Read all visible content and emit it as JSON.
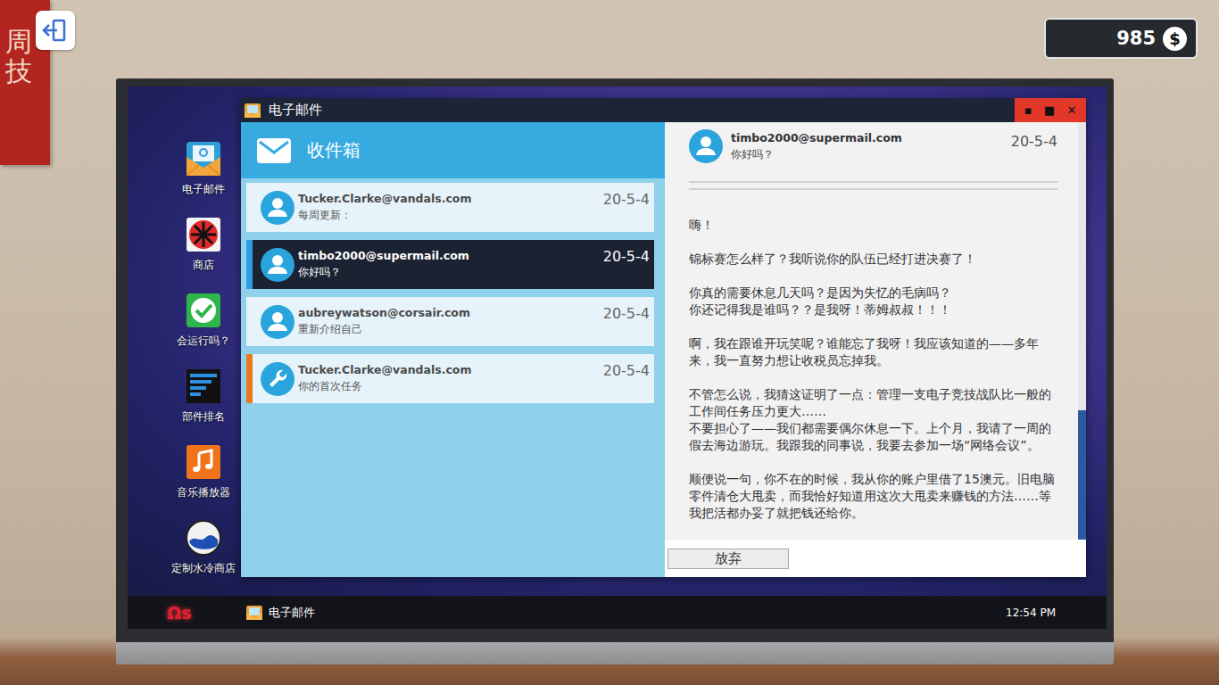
{
  "banner": {
    "text": "周技"
  },
  "money": {
    "amount": "985",
    "icon": "$"
  },
  "desktop": {
    "icons": [
      {
        "label": "电子邮件",
        "kind": "mail"
      },
      {
        "label": "商店",
        "kind": "shop"
      },
      {
        "label": "会运行吗？",
        "kind": "check"
      },
      {
        "label": "部件排名",
        "kind": "ranking"
      },
      {
        "label": "音乐播放器",
        "kind": "music"
      },
      {
        "label": "定制水冷商店",
        "kind": "cooling"
      }
    ]
  },
  "window": {
    "title": "电子邮件",
    "controls": [
      "▪",
      "■",
      "✕"
    ]
  },
  "inbox": {
    "title": "收件箱",
    "mails": [
      {
        "from": "Tucker.Clarke@vandals.com",
        "subject": "每周更新：",
        "date": "20-5-4",
        "kind": "message",
        "selected": false
      },
      {
        "from": "timbo2000@supermail.com",
        "subject": "你好吗？",
        "date": "20-5-4",
        "kind": "message",
        "selected": true
      },
      {
        "from": "aubreywatson@corsair.com",
        "subject": "重新介绍自己",
        "date": "20-5-4",
        "kind": "message",
        "selected": false
      },
      {
        "from": "Tucker.Clarke@vandals.com",
        "subject": "你的首次任务",
        "date": "20-5-4",
        "kind": "task",
        "selected": false
      }
    ]
  },
  "message": {
    "from": "timbo2000@supermail.com",
    "subject": "你好吗？",
    "date": "20-5-4",
    "paragraphs": [
      [
        "嗨！"
      ],
      [
        "锦标赛怎么样了？我听说你的队伍已经打进决赛了！"
      ],
      [
        "你真的需要休息几天吗？是因为失忆的毛病吗？",
        "你还记得我是谁吗？？是我呀！蒂姆叔叔！！！"
      ],
      [
        "啊，我在跟谁开玩笑呢？谁能忘了我呀！我应该知道的——多年来，我一直努力想让收税员忘掉我。"
      ],
      [
        "不管怎么说，我猜这证明了一点：管理一支电子竞技战队比一般的工作间任务压力更大……",
        "不要担心了——我们都需要偶尔休息一下。上个月，我请了一周的假去海边游玩。我跟我的同事说，我要去参加一场“网络会议”。"
      ],
      [
        "顺便说一句，你不在的时候，我从你的账户里借了15澳元。旧电脑零件清仓大甩卖，而我恰好知道用这次大甩卖来赚钱的方法……等我把活都办妥了就把钱还给你。"
      ]
    ],
    "scrollbar": {
      "level": 1,
      "thumb": 0.31
    }
  },
  "buttons": [
    "放弃"
  ],
  "taskbar": {
    "logo": "Ωs",
    "tasks": [
      {
        "label": "电子邮件"
      }
    ],
    "clock": "12:54 PM"
  }
}
